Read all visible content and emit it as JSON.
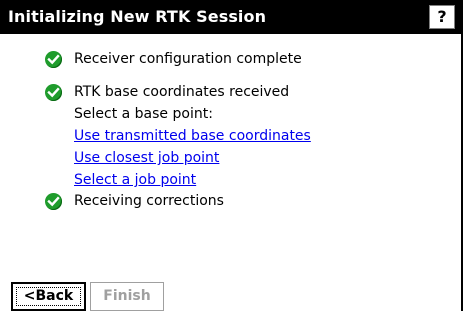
{
  "window": {
    "title": "Initializing New RTK Session",
    "help_label": "?"
  },
  "status": [
    {
      "icon": "check-circle-icon",
      "text": "Receiver configuration complete"
    },
    {
      "icon": "check-circle-icon",
      "text": "RTK base coordinates received"
    },
    {
      "icon": "check-circle-icon",
      "text": "Receiving corrections"
    }
  ],
  "base_point": {
    "prompt": "Select a base point:",
    "options": [
      "Use transmitted base coordinates",
      "Use closest job point",
      "Select a job point"
    ]
  },
  "buttons": {
    "back": "<Back",
    "finish": "Finish"
  },
  "colors": {
    "check_green": "#1f9c2c",
    "link_blue": "#0000ee",
    "disabled_gray": "#a0a0a0"
  }
}
